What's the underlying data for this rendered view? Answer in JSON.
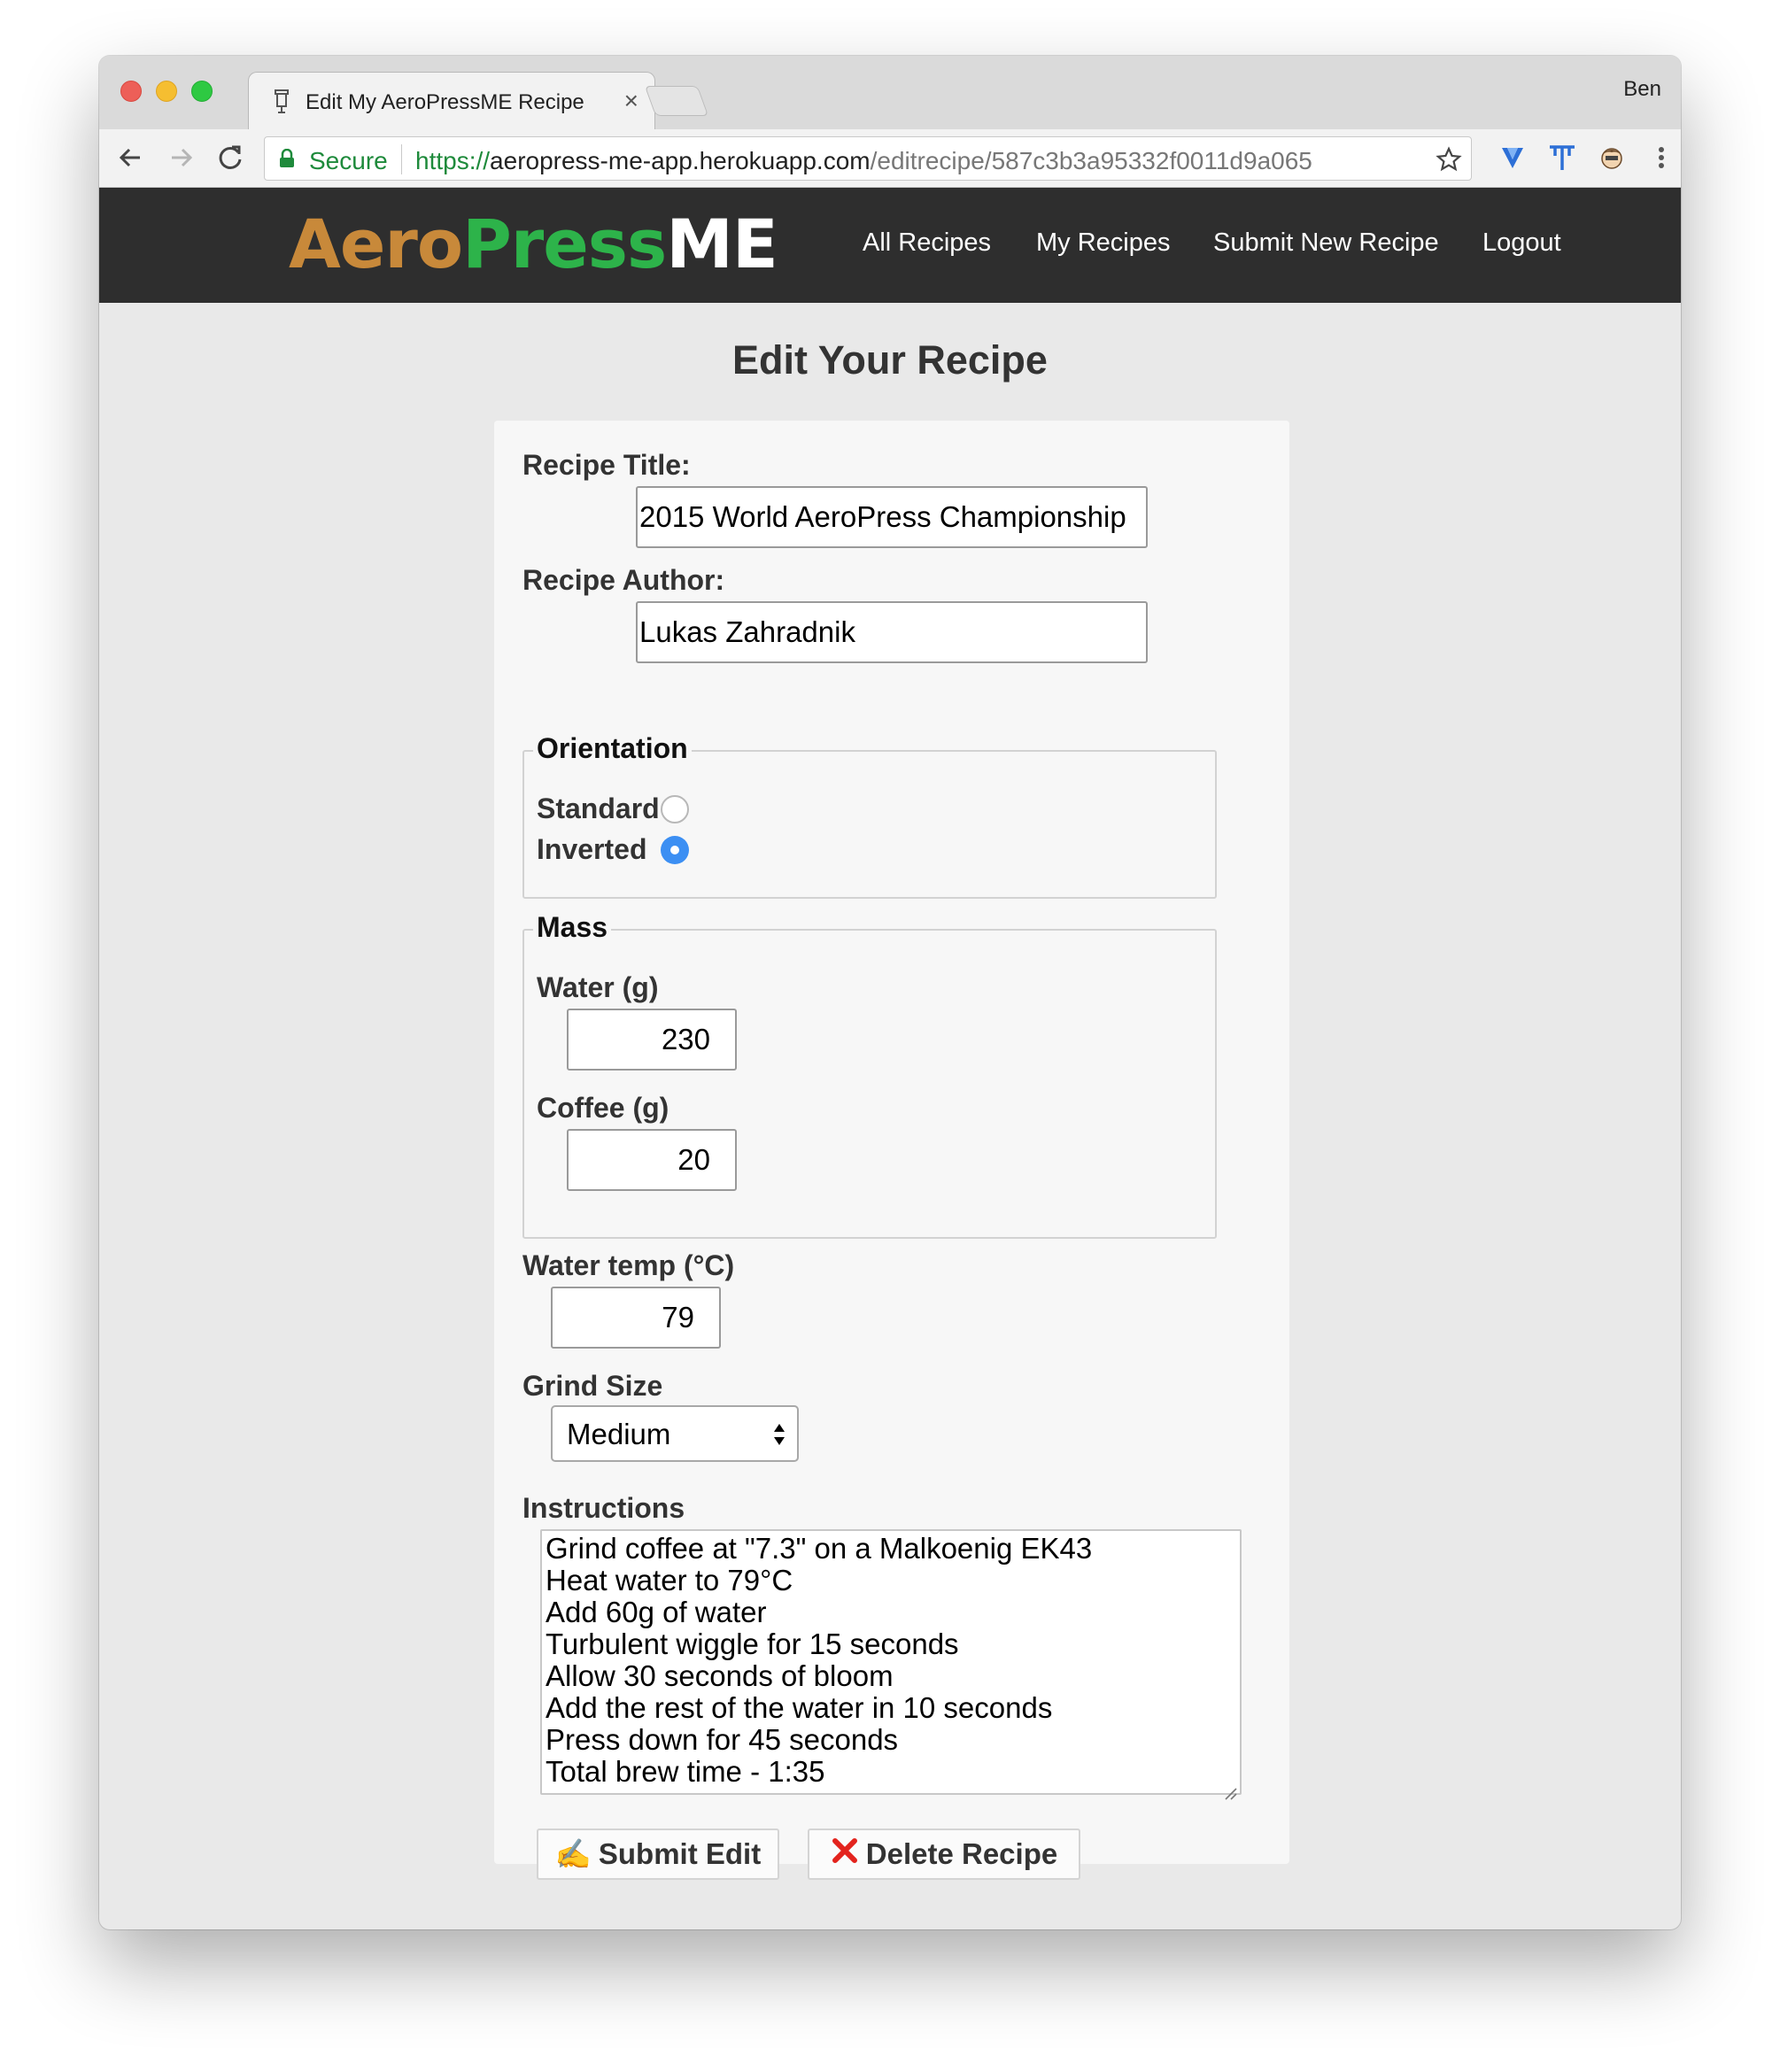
{
  "browser": {
    "tab_title": "Edit My AeroPressME Recipe",
    "tab_close": "×",
    "profile": "Ben",
    "secure_label": "Secure",
    "url_scheme": "https://",
    "url_host": "aeropress-me-app.herokuapp.com",
    "url_path": "/editrecipe/587c3b3a95332f0011d9a065"
  },
  "nav": {
    "logo": {
      "aero": "Aero",
      "press": "Press",
      "me": "ME"
    },
    "links": [
      "All Recipes",
      "My Recipes",
      "Submit New Recipe",
      "Logout"
    ]
  },
  "page": {
    "title": "Edit Your Recipe"
  },
  "form": {
    "recipe_title_label": "Recipe Title:",
    "recipe_title_value": "2015 World AeroPress Championship",
    "recipe_author_label": "Recipe Author:",
    "recipe_author_value": "Lukas Zahradnik",
    "orientation": {
      "legend": "Orientation",
      "options": [
        {
          "label": "Standard",
          "selected": false
        },
        {
          "label": "Inverted",
          "selected": true
        }
      ]
    },
    "mass": {
      "legend": "Mass",
      "water_label": "Water (g)",
      "water_value": "230",
      "coffee_label": "Coffee (g)",
      "coffee_value": "20"
    },
    "water_temp_label": "Water temp (°C)",
    "water_temp_value": "79",
    "grind_label": "Grind Size",
    "grind_value": "Medium",
    "instructions_label": "Instructions",
    "instructions_lines": [
      "Grind coffee at \"7.3\" on a Malkoenig EK43",
      "Heat water to 79°C",
      "Add 60g of water",
      "Turbulent wiggle for 15 seconds",
      "Allow 30 seconds of bloom",
      "Add the rest of the water in 10 seconds",
      "Press down for 45 seconds",
      "Total brew time - 1:35"
    ],
    "submit_icon": "✍",
    "submit_label": "Submit Edit",
    "delete_icon": "❌",
    "delete_label": "Delete Recipe"
  },
  "colors": {
    "nav_bg": "#2e2e2e",
    "logo_aero": "#c8893a",
    "logo_press": "#2db34a",
    "radio_selected": "#3c8ff3",
    "page_bg": "#e9e9e9"
  }
}
